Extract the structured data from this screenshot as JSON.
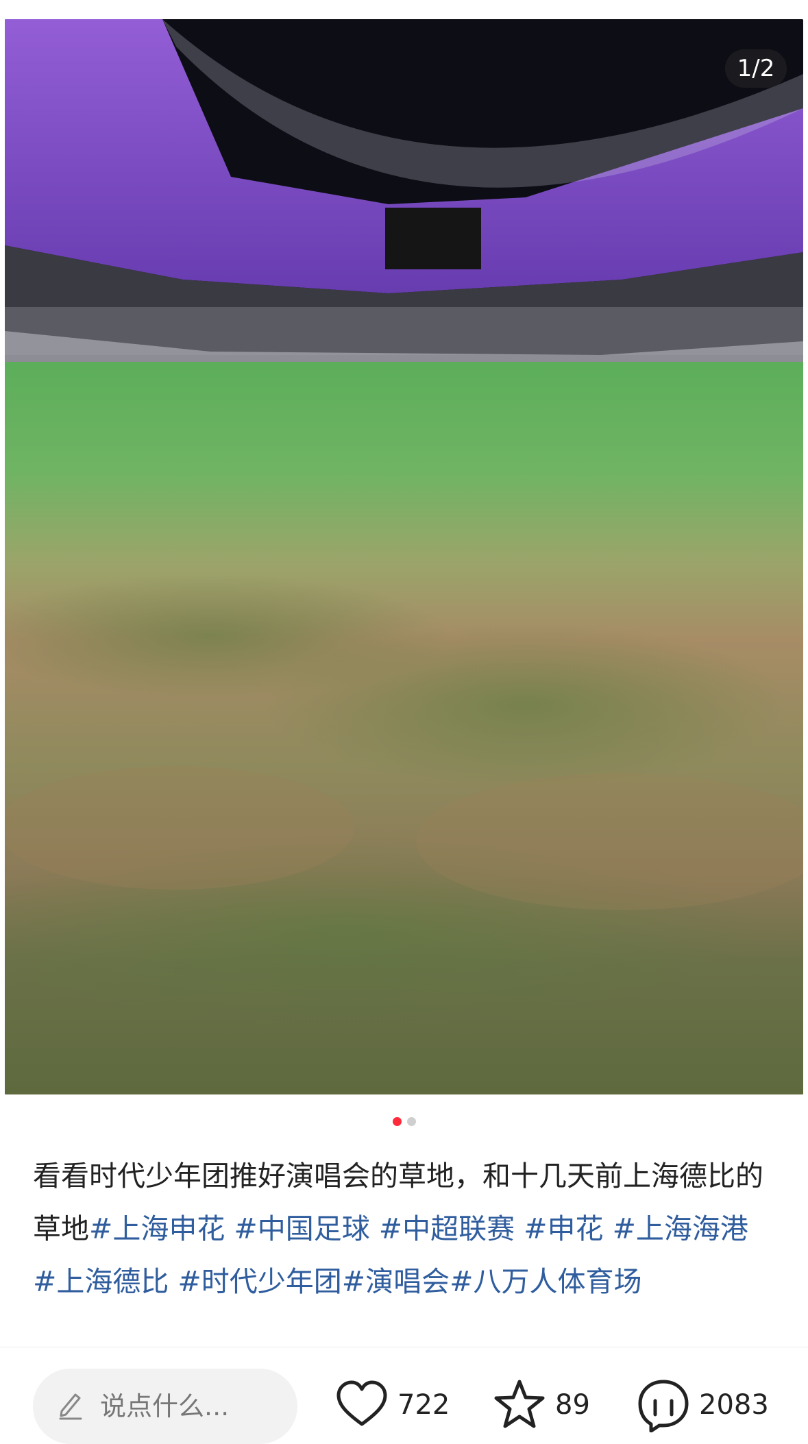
{
  "image_counter": "1/2",
  "pagination": {
    "count": 2,
    "active": 0
  },
  "caption": {
    "text": "看看时代少年团推好演唱会的草地，和十几天前上海德比的草地",
    "tags": [
      "#上海申花 ",
      "#中国足球 ",
      "#中超联赛 ",
      "#申花 ",
      "#上海海港 ",
      "#上海德比 ",
      "#时代少年团",
      "#演唱会",
      "#八万人体育场"
    ]
  },
  "bottom_bar": {
    "comment_placeholder": "说点什么...",
    "likes": "722",
    "favorites": "89",
    "comments": "2083"
  },
  "colors": {
    "accent": "#ff2a3a",
    "hashtag": "#2f5d9e",
    "stadium_light": "#8a4fd6"
  }
}
